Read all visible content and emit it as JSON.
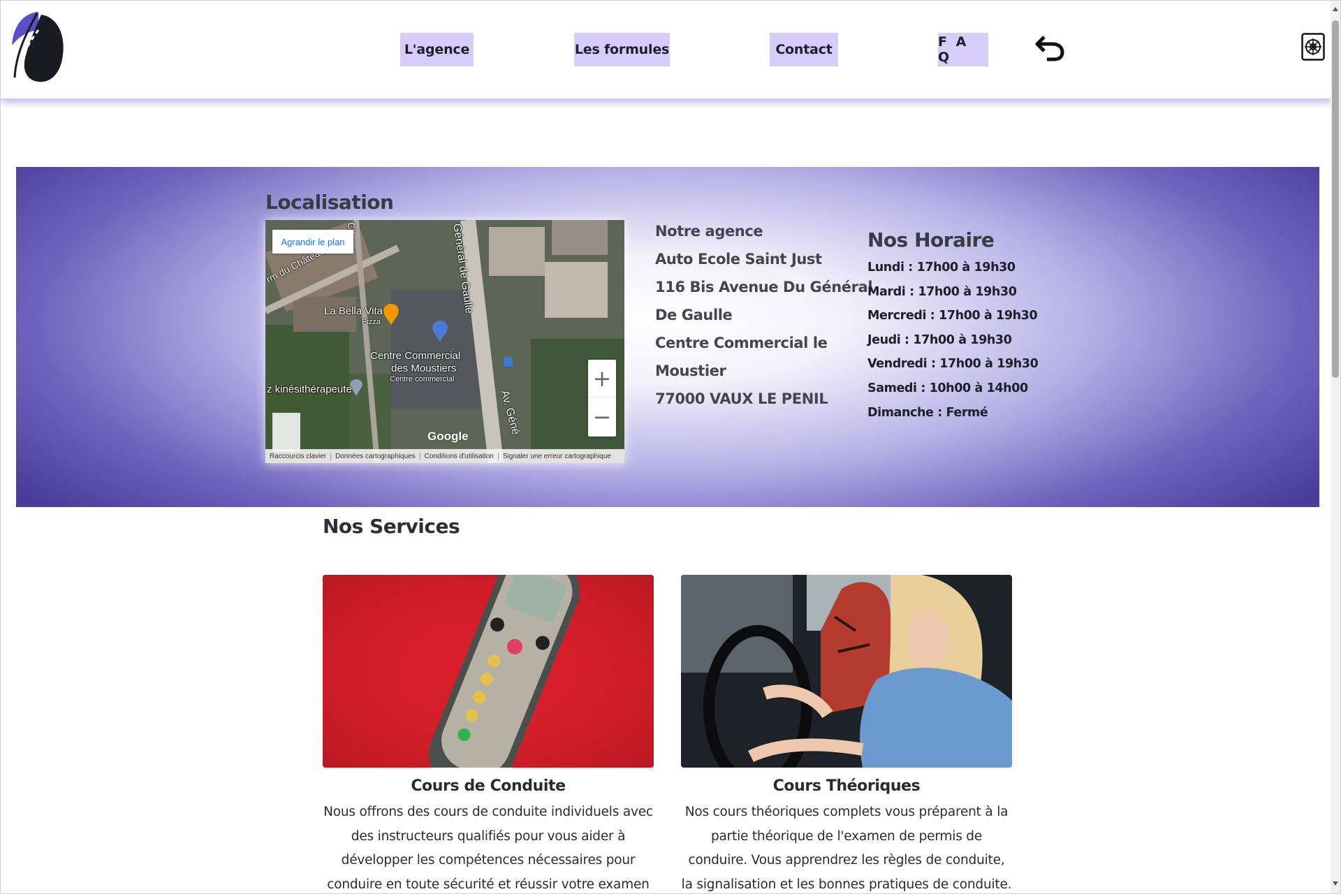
{
  "nav": {
    "agence": "L'agence",
    "formules": "Les formules",
    "contact": "Contact",
    "faq": "F A Q"
  },
  "icons": {
    "logo": "road-logo-icon",
    "back": "undo-arrow-icon",
    "settings": "gear-icon"
  },
  "colors": {
    "nav_button_bg": "#d7cdfb",
    "banner_dark": "#4a3d97",
    "banner_light": "#ffffff",
    "logo_purple": "#5a4fc7"
  },
  "localisation": {
    "title": "Localisation",
    "map": {
      "expand_label": "Agrandir le plan",
      "labels": {
        "street_chateau": "rm du Château",
        "bella_vita": "La Bella Vita",
        "pizza": "Pizza",
        "centre1": "Centre Commercial",
        "centre2": "des Moustiers",
        "centre3": "Centre commercial",
        "kine": "z kinésithérapeute",
        "gaulle": "Général de Gaulle",
        "av_gene": "Av. Géné",
        "ch": "Ch"
      },
      "google": "Google",
      "footer": {
        "shortcuts": "Raccourcis clavier",
        "data": "Données cartographiques",
        "terms": "Conditions d'utilisation",
        "report": "Signaler une erreur cartographique"
      },
      "zoom_in": "+",
      "zoom_out": "−"
    },
    "agency": {
      "line1": "Notre agence",
      "line2": "Auto Ecole Saint Just",
      "line3": "116 Bis Avenue Du Général",
      "line4": "De Gaulle",
      "line5": "Centre Commercial le",
      "line6": "Moustier",
      "line7": "77000 VAUX LE PENIL"
    },
    "hours": {
      "title": "Nos Horaire",
      "rows": [
        "Lundi : 17h00 à 19h30",
        "Mardi : 17h00 à 19h30",
        "Mercredi : 17h00 à 19h30",
        "Jeudi : 17h00 à 19h30",
        "Vendredi : 17h00 à 19h30",
        "Samedi : 10h00 à 14h00",
        "Dimanche : Fermé"
      ]
    }
  },
  "services": {
    "title": "Nos Services",
    "cards": [
      {
        "title": "Cours de Conduite",
        "text": "Nous offrons des cours de conduite individuels avec des instructeurs qualifiés pour vous aider à développer les compétences nécessaires pour conduire en toute sécurité et réussir votre examen de permis de conduire."
      },
      {
        "title": "Cours Théoriques",
        "text": "Nos cours théoriques complets vous préparent à la partie théorique de l'examen de permis de conduire. Vous apprendrez les règles de conduite, la signalisation et les bonnes pratiques de conduite."
      }
    ]
  }
}
